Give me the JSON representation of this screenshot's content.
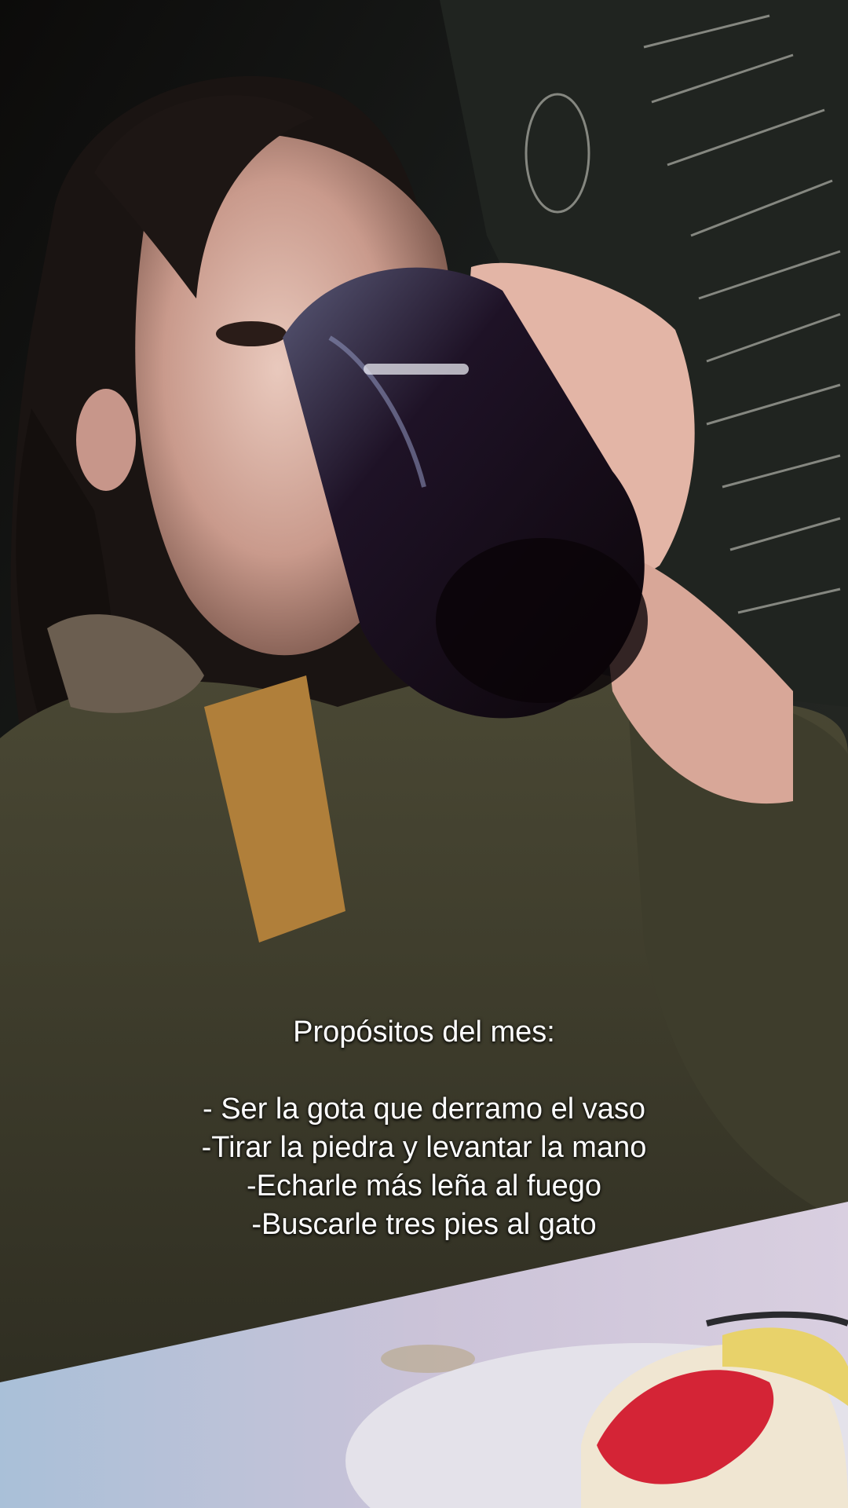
{
  "caption": {
    "title": "Propósitos del mes:",
    "lines": [
      "- Ser la gota que derramo el vaso",
      "-Tirar la piedra y levantar la mano",
      "-Echarle más leña al fuego",
      "-Buscarle tres pies al gato"
    ]
  },
  "scene": {
    "description_colors": {
      "wall": "#1c1f1c",
      "jacket": "#3b3a2a",
      "table": "#c9c2d6",
      "drink": "#1a0d10"
    }
  }
}
